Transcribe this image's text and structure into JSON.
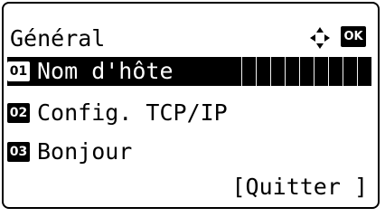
{
  "screen": {
    "title": "Général",
    "ok_label": "OK",
    "nav_icon": "four-way-arrow-icon",
    "items": [
      {
        "number": "01",
        "label": "Nom d'hôte",
        "selected": true
      },
      {
        "number": "02",
        "label": "Config. TCP/IP",
        "selected": false
      },
      {
        "number": "03",
        "label": "Bonjour",
        "selected": false
      }
    ],
    "quit_label": "[Quitter ]"
  }
}
